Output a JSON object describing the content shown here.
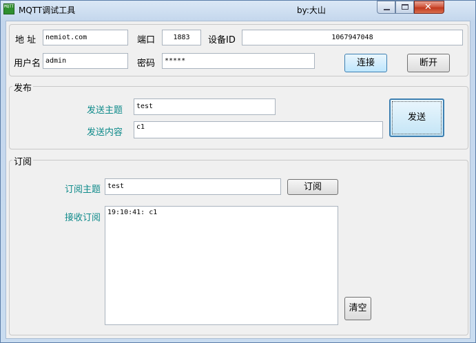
{
  "window": {
    "title": "MQTT调试工具",
    "author": "by:大山",
    "icon_text": "MQTT"
  },
  "connection": {
    "address_label": "地 址",
    "address_value": "nemiot.com",
    "port_label": "端口",
    "port_value": "1883",
    "device_id_label": "设备ID",
    "device_id_value": "1067947048",
    "username_label": "用户名",
    "username_value": "admin",
    "password_label": "密码",
    "password_value": "*****",
    "connect_button": "连接",
    "disconnect_button": "断开"
  },
  "publish": {
    "group_title": "发布",
    "topic_label": "发送主题",
    "topic_value": "test",
    "content_label": "发送内容",
    "content_value": "c1",
    "send_button": "发送"
  },
  "subscribe": {
    "group_title": "订阅",
    "topic_label": "订阅主题",
    "topic_value": "test",
    "subscribe_button": "订阅",
    "receive_label": "接收订阅",
    "received_text": "19:10:41: c1",
    "clear_button": "清空"
  }
}
